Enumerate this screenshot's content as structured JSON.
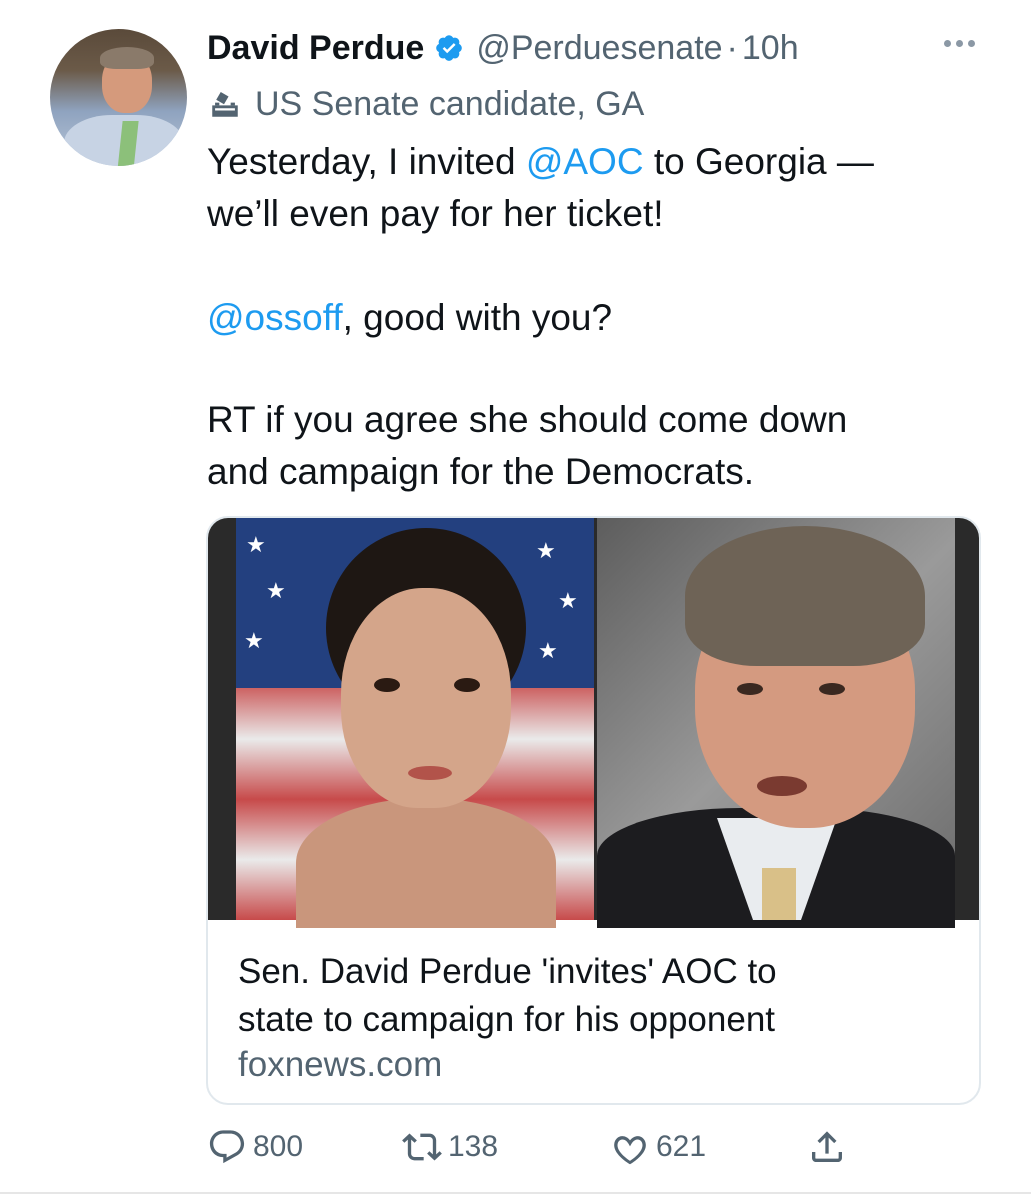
{
  "tweet": {
    "author_name": "David Perdue",
    "author_handle": "@Perduesenate",
    "separator": "·",
    "time": "10h",
    "label": "US Senate candidate, GA",
    "line1_pre": "Yesterday, I invited ",
    "line1_mention": "@AOC",
    "line1_post": " to Georgia —",
    "line2": "we’ll even pay for her ticket!",
    "line3_mention": "@ossoff",
    "line3_post": ", good with you?",
    "line4": "RT if you agree she should come down",
    "line5": "and campaign for the Democrats."
  },
  "card": {
    "title_line1": "Sen. David Perdue 'invites' AOC to",
    "title_line2": "state to campaign for his opponent",
    "domain": "foxnews.com"
  },
  "actions": {
    "replies": "800",
    "retweets": "138",
    "likes": "621"
  },
  "icons": {
    "verified": "verified-badge-icon",
    "more": "more-horizontal-icon",
    "label": "ballot-box-icon",
    "reply": "reply-icon",
    "retweet": "retweet-icon",
    "like": "heart-icon",
    "share": "share-icon"
  },
  "colors": {
    "accent": "#1d9bf0",
    "secondary_text": "#536471"
  }
}
